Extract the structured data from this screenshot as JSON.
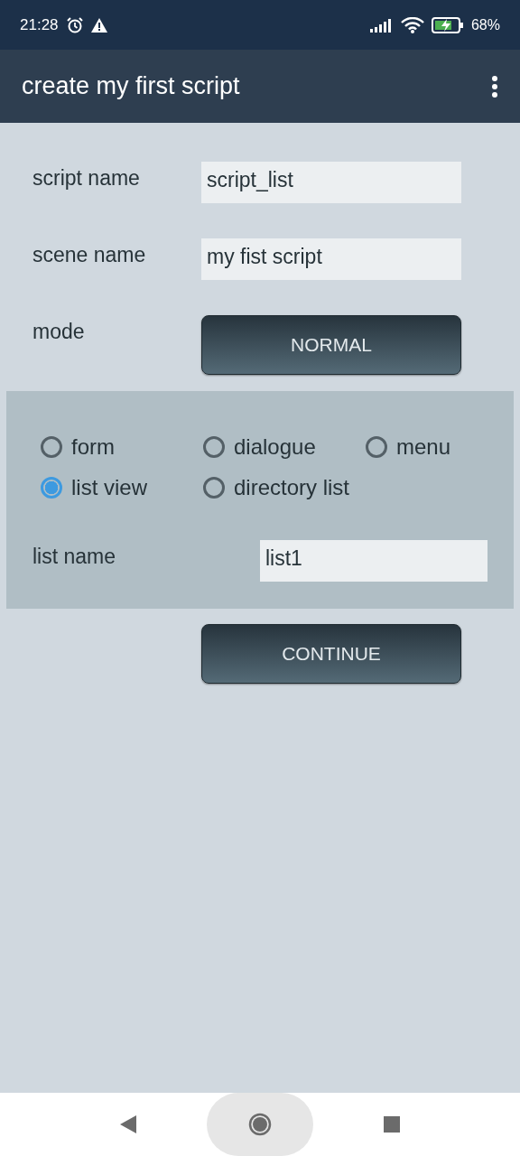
{
  "status_bar": {
    "time": "21:28",
    "battery": "68%"
  },
  "app_bar": {
    "title": "create my first script"
  },
  "fields": [
    {
      "label": "script name",
      "value": "script_list"
    },
    {
      "label": "scene name",
      "value": "my fist script"
    }
  ],
  "mode": {
    "label": "mode",
    "button": "NORMAL"
  },
  "options": [
    {
      "label": "form",
      "selected": false
    },
    {
      "label": "dialogue",
      "selected": false
    },
    {
      "label": "menu",
      "selected": false
    },
    {
      "label": "list view",
      "selected": true
    },
    {
      "label": "directory list",
      "selected": false
    }
  ],
  "list_name": {
    "label": "list name",
    "value": "list1"
  },
  "continue_button": "CONTINUE"
}
